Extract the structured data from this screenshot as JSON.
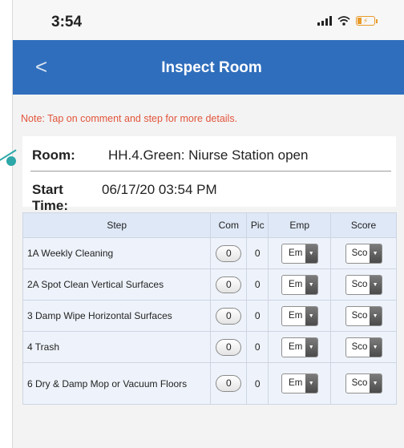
{
  "status_bar": {
    "time": "3:54"
  },
  "nav": {
    "back_glyph": "<",
    "title": "Inspect Room"
  },
  "note": "Note: Tap on comment and step for more details.",
  "info": {
    "room_label": "Room:",
    "room_value": "HH.4.Green: Niurse Station open",
    "start_label": "Start Time:",
    "start_value": "06/17/20 03:54 PM"
  },
  "table": {
    "headers": [
      "Step",
      "Com",
      "Pic",
      "Emp",
      "Score"
    ],
    "rows": [
      {
        "step": "1A Weekly Cleaning",
        "com": "0",
        "pic": "0",
        "emp": "Em",
        "score": "Sco"
      },
      {
        "step": "2A Spot Clean Vertical Surfaces",
        "com": "0",
        "pic": "0",
        "emp": "Em",
        "score": "Sco"
      },
      {
        "step": "3 Damp Wipe Horizontal Surfaces",
        "com": "0",
        "pic": "0",
        "emp": "Em",
        "score": "Sco"
      },
      {
        "step": "4 Trash",
        "com": "0",
        "pic": "0",
        "emp": "Em",
        "score": "Sco"
      },
      {
        "step": "6 Dry & Damp Mop or Vacuum Floors",
        "com": "0",
        "pic": "0",
        "emp": "Em",
        "score": "Sco"
      }
    ]
  },
  "colors": {
    "nav_bar": "#2f6ebc",
    "note_text": "#e2553b",
    "battery": "#e89a2a",
    "pointer": "#2da7a8"
  },
  "icons": {
    "back": "chevron-left-icon",
    "signal": "signal-icon",
    "wifi": "wifi-icon",
    "battery": "battery-charging-icon",
    "dropdown": "triangle-down-icon"
  }
}
